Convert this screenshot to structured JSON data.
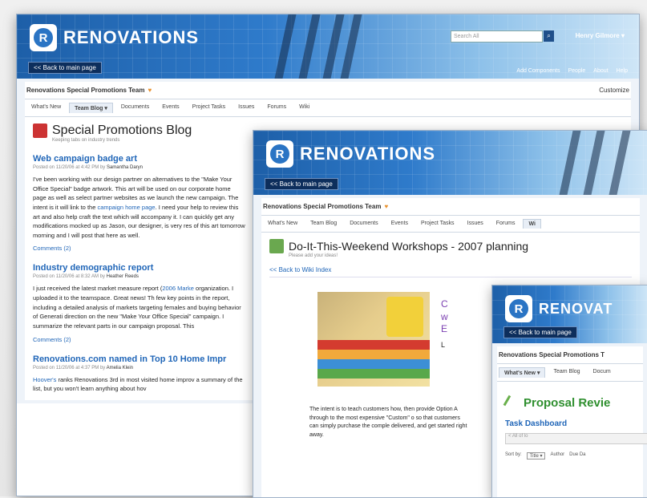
{
  "window1": {
    "brand": "RENOVATIONS",
    "back_label": "<< Back to main page",
    "search_placeholder": "Search All",
    "search_icon": "search-icon",
    "user": "Henry Gilmore ▾",
    "top_links": [
      "Add Components",
      "People",
      "About",
      "Help"
    ],
    "team": "Renovations Special Promotions Team",
    "team_right": "Customize",
    "tabs": [
      "What's New",
      "Team Blog ▾",
      "Documents",
      "Events",
      "Project Tasks",
      "Issues",
      "Forums",
      "Wiki"
    ],
    "active_tab": 1,
    "blog_title": "Special Promotions Blog",
    "blog_subtitle": "Keeping tabs on industry trends",
    "posts": [
      {
        "title": "Web campaign badge art",
        "meta": "Posted on 11/20/06 at 4:42 PM by",
        "author": "Samantha Daryn",
        "body": "I've been working with our design partner on alternatives to the \"Make Your Office Special\" badge artwork. This art will be used on our corporate home page as well as select partner websites as we launch the new campaign. The intent is it will link to the",
        "link": "campaign home page",
        "body2": ". I need your help to review this art and also help craft the text which will accompany it. I can quickly get any modifications mocked up as Jason, our designer, is very res of this art tomorrow morning and I will post that here as well.",
        "comments": "Comments (2)"
      },
      {
        "title": "Industry demographic report",
        "meta": "Posted on 11/20/06 at 8:32 AM by",
        "author": "Heather Reeds",
        "body": "I just received the latest market measure report (",
        "link": "2006 Marke",
        "body2": " organization. I uploaded it to the teamspace. Great news! Th few key points in the report, including a detailed analysis of markets targeting females and buying behavior of Generati direction on the new \"Make Your Office Special\" campaign. I summarize the relevant parts in our campaign proposal. This",
        "comments": "Comments (2)"
      },
      {
        "title": "Renovations.com named in Top 10 Home Impr",
        "meta": "Posted on 11/20/06 at 4:37 PM by",
        "author": "Amelia Klein",
        "body": "",
        "link": "Hoover's",
        "body2": " ranks Renovations 3rd in most visited home improv a summary of the list, but you won't learn anything about hov",
        "comments": ""
      }
    ]
  },
  "window2": {
    "brand": "RENOVATIONS",
    "back_label": "<< Back to main page",
    "team": "Renovations Special Promotions Team",
    "tabs": [
      "What's New",
      "Team Blog",
      "Documents",
      "Events",
      "Project Tasks",
      "Issues",
      "Forums",
      "Wi"
    ],
    "wiki_title": "Do-It-This-Weekend Workshops - 2007 planning",
    "wiki_subtitle": "Please add your ideas!",
    "back_wiki": "<< Back to Wiki Index",
    "wiki_text": "The intent is to teach customers how, then provide Option A through to the most expensive \"Custom\" o so that customers can simply purchase the comple delivered, and get started right away.",
    "side_letters": [
      "C",
      "w",
      "E",
      "L"
    ]
  },
  "window3": {
    "brand": "RENOVAT",
    "back_label": "<< Back to main page",
    "team": "Renovations Special Promotions T",
    "tabs": [
      "What's New ▾",
      "Team Blog",
      "Docum"
    ],
    "proposal_title": "Proposal Revie",
    "task_dashboard": "Task Dashboard",
    "input_text": "< All of lo",
    "sort_label": "Sort by:",
    "sort_value": "Title ▾",
    "sort_extra": [
      "Author",
      "Due Da"
    ]
  },
  "colors": {
    "brand_blue": "#2066b8",
    "banner_dark": "#0d2e5c",
    "green": "#2f8f2f"
  }
}
